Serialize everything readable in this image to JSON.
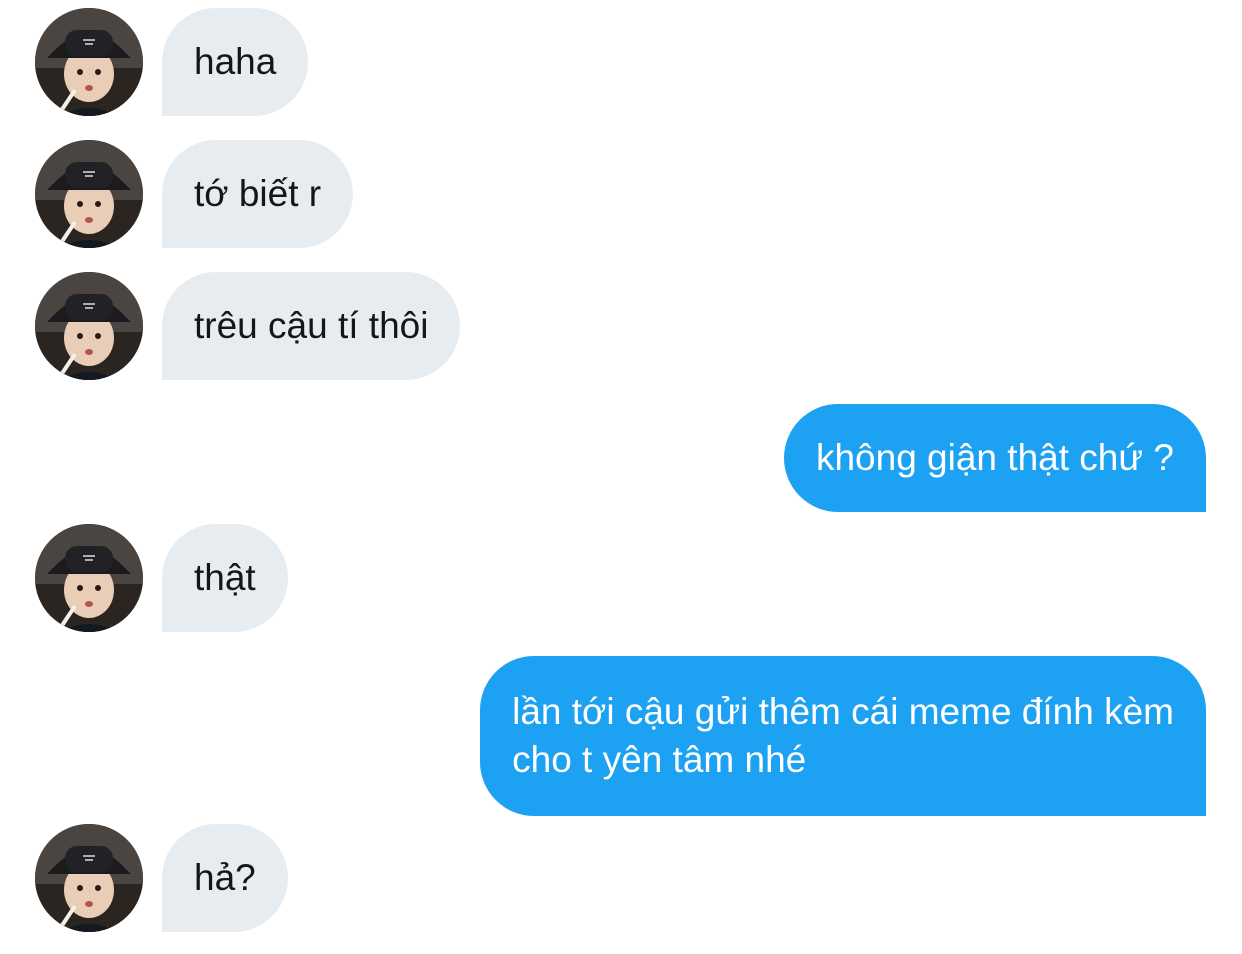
{
  "colors": {
    "incoming_bubble": "#e6ecf0",
    "outgoing_bubble": "#1da1f2",
    "incoming_text": "#14171a",
    "outgoing_text": "#ffffff"
  },
  "messages": [
    {
      "direction": "incoming",
      "text": "haha"
    },
    {
      "direction": "incoming",
      "text": "tớ biết r"
    },
    {
      "direction": "incoming",
      "text": "trêu cậu tí thôi"
    },
    {
      "direction": "outgoing",
      "text": "không giận thật chứ ?"
    },
    {
      "direction": "incoming",
      "text": "thật"
    },
    {
      "direction": "outgoing",
      "lines": [
        "lần tới cậu gửi thêm cái meme đính kèm",
        "cho t yên tâm nhé"
      ]
    },
    {
      "direction": "incoming",
      "text": "hả?"
    }
  ],
  "avatar": {
    "icon": "user-avatar-photo"
  }
}
